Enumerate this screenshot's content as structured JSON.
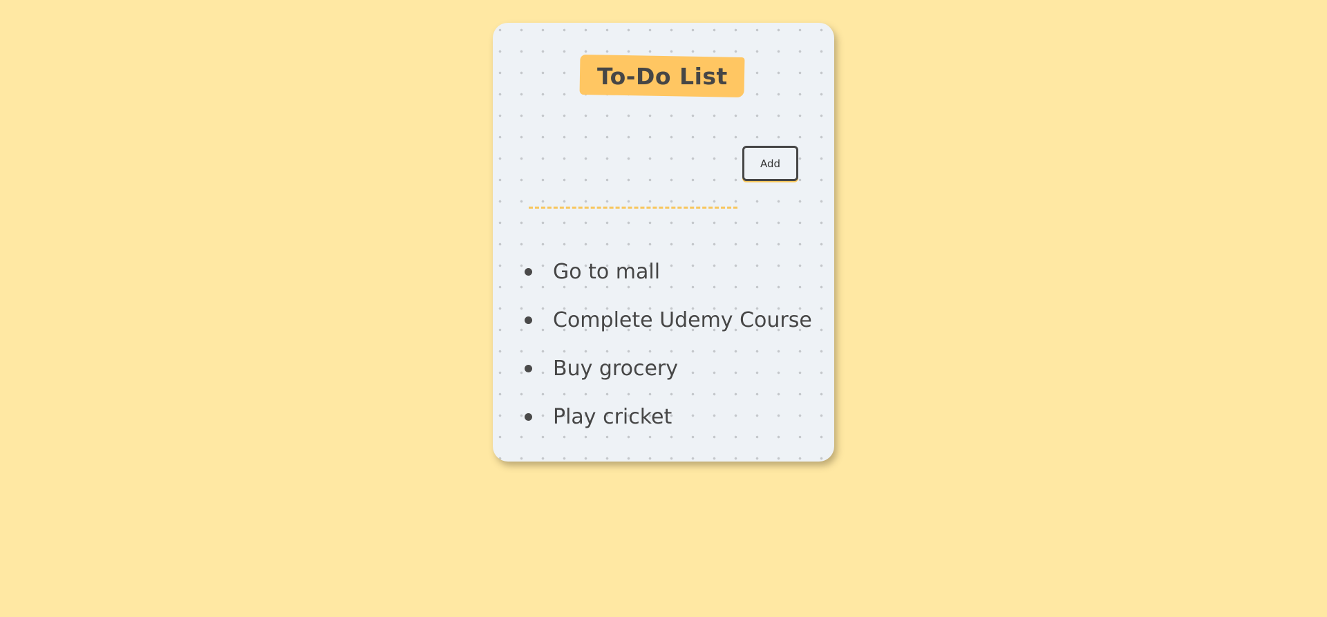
{
  "app": {
    "title": "To-Do List"
  },
  "input": {
    "value": "",
    "placeholder": ""
  },
  "add_button": {
    "label": "Add"
  },
  "todos": [
    {
      "text": "Go to mall"
    },
    {
      "text": "Complete Udemy Course"
    },
    {
      "text": "Buy grocery"
    },
    {
      "text": "Play cricket"
    }
  ],
  "colors": {
    "background": "#ffe8a3",
    "card": "#eef2f6",
    "accent": "#ffc662",
    "text": "#464646"
  }
}
